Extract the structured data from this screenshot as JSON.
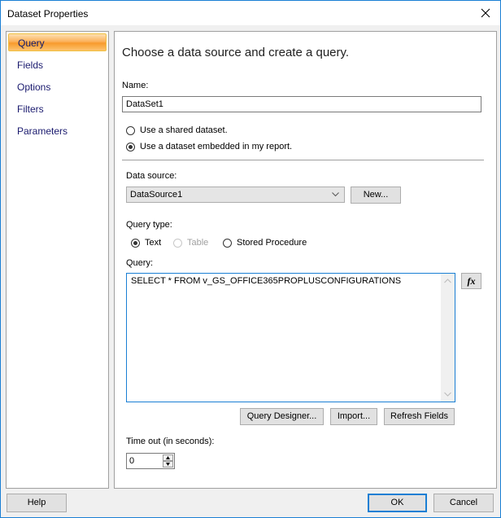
{
  "window": {
    "title": "Dataset Properties",
    "close_icon": "close-icon"
  },
  "nav": {
    "items": [
      {
        "label": "Query",
        "selected": true
      },
      {
        "label": "Fields",
        "selected": false
      },
      {
        "label": "Options",
        "selected": false
      },
      {
        "label": "Filters",
        "selected": false
      },
      {
        "label": "Parameters",
        "selected": false
      }
    ],
    "selected_color": "#f8a035"
  },
  "main": {
    "heading": "Choose a data source and create a query.",
    "name_label": "Name:",
    "name_value": "DataSet1",
    "source_options": [
      {
        "label": "Use a shared dataset.",
        "checked": false
      },
      {
        "label": "Use a dataset embedded in my report.",
        "checked": true
      }
    ],
    "data_source_label": "Data source:",
    "data_source_value": "DataSource1",
    "new_button": "New...",
    "query_type_label": "Query type:",
    "query_types": [
      {
        "label": "Text",
        "checked": true,
        "enabled": true
      },
      {
        "label": "Table",
        "checked": false,
        "enabled": false
      },
      {
        "label": "Stored Procedure",
        "checked": false,
        "enabled": true
      }
    ],
    "query_label": "Query:",
    "query_value": "SELECT * FROM v_GS_OFFICE365PROPLUSCONFIGURATIONS",
    "expression_button": "fx",
    "query_designer_button": "Query Designer...",
    "import_button": "Import...",
    "refresh_fields_button": "Refresh Fields",
    "timeout_label": "Time out (in seconds):",
    "timeout_value": "0"
  },
  "footer": {
    "help": "Help",
    "ok": "OK",
    "cancel": "Cancel"
  },
  "colors": {
    "accent": "#1a7fd4"
  }
}
